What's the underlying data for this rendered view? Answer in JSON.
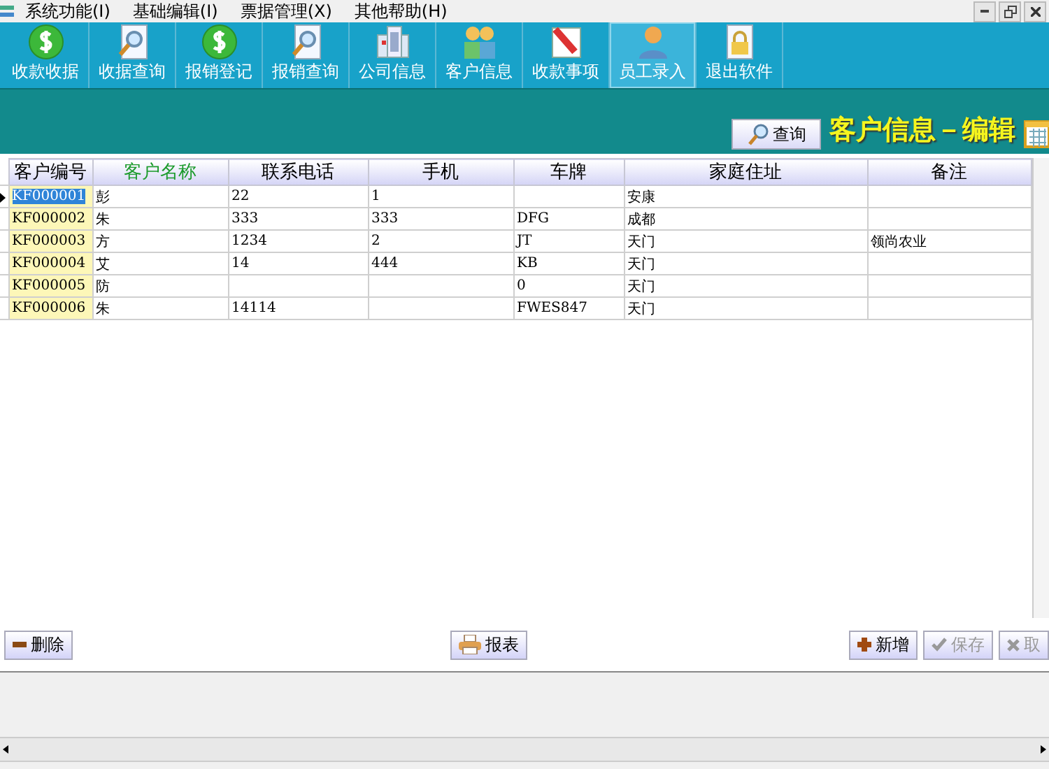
{
  "menu": [
    "系统功能(I)",
    "基础编辑(I)",
    "票据管理(X)",
    "其他帮助(H)"
  ],
  "toolbar": [
    {
      "label": "收款收据",
      "selected": false
    },
    {
      "label": "收据查询",
      "selected": false
    },
    {
      "label": "报销登记",
      "selected": false
    },
    {
      "label": "报销查询",
      "selected": false
    },
    {
      "label": "公司信息",
      "selected": false
    },
    {
      "label": "客户信息",
      "selected": false
    },
    {
      "label": "收款事项",
      "selected": false
    },
    {
      "label": "员工录入",
      "selected": true
    },
    {
      "label": "退出软件",
      "selected": false
    }
  ],
  "search_button": "查询",
  "page_title": "客户信息－编辑",
  "table": {
    "columns": [
      {
        "label": "客户编号",
        "highlighted": false
      },
      {
        "label": "客户名称",
        "highlighted": true
      },
      {
        "label": "联系电话",
        "highlighted": false
      },
      {
        "label": "手机",
        "highlighted": false
      },
      {
        "label": "车牌",
        "highlighted": false
      },
      {
        "label": "家庭住址",
        "highlighted": false
      },
      {
        "label": "备注",
        "highlighted": false
      }
    ],
    "rows": [
      {
        "cells": [
          "KF000001",
          "彭",
          "22",
          "1",
          "",
          "安康",
          ""
        ],
        "selected": true
      },
      {
        "cells": [
          "KF000002",
          "朱",
          "333",
          "333",
          "DFG",
          "成都",
          ""
        ],
        "selected": false
      },
      {
        "cells": [
          "KF000003",
          "方",
          "1234",
          "2",
          "JT",
          "天门",
          "领尚农业"
        ],
        "selected": false
      },
      {
        "cells": [
          "KF000004",
          "艾",
          "14",
          "444",
          "KB",
          "天门",
          ""
        ],
        "selected": false
      },
      {
        "cells": [
          "KF000005",
          "防",
          "",
          "",
          "0",
          "天门",
          ""
        ],
        "selected": false
      },
      {
        "cells": [
          "KF000006",
          "朱",
          "14114",
          "",
          "FWES847",
          "天门",
          ""
        ],
        "selected": false
      }
    ]
  },
  "buttons": [
    {
      "label": "删除",
      "disabled": false
    },
    {
      "label": "报表",
      "disabled": false
    },
    {
      "label": "新增",
      "disabled": false
    },
    {
      "label": "保存",
      "disabled": true
    },
    {
      "label": "取",
      "disabled": true
    }
  ]
}
